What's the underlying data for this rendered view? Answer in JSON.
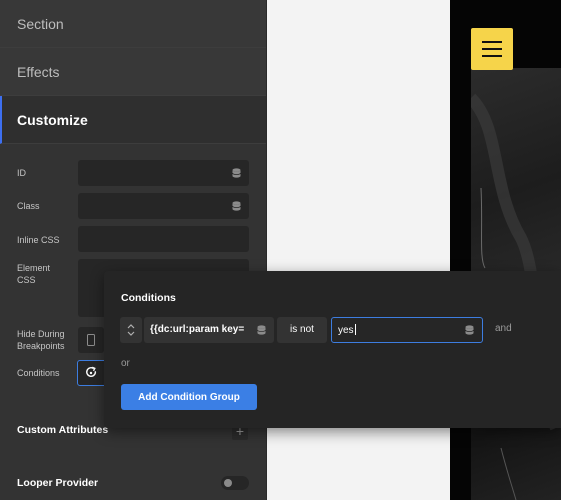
{
  "panel": {
    "accordions": {
      "section": "Section",
      "effects": "Effects",
      "customize": "Customize"
    },
    "fields": {
      "id_label": "ID",
      "class_label": "Class",
      "inline_css_label": "Inline CSS",
      "element_css_label": "Element CSS",
      "hide_breakpoints_label": "Hide During Breakpoints",
      "conditions_label": "Conditions"
    },
    "custom_attributes_title": "Custom Attributes",
    "looper_provider_title": "Looper Provider",
    "plus_symbol": "+"
  },
  "conditions_popover": {
    "title": "Conditions",
    "row": {
      "key_value": "{{dc:url:param key=",
      "operator": "is not",
      "value": "yes",
      "and_text": "and"
    },
    "or_text": "or",
    "add_group_label": "Add Condition Group"
  },
  "colors": {
    "accent": "#3b7fe5",
    "panel_bg": "#333333",
    "hamburger_bg": "#f6d44a"
  },
  "icons": [
    "database-icon",
    "phone-icon",
    "conditions-icon",
    "sort-icon",
    "hamburger-icon",
    "plus-icon"
  ]
}
